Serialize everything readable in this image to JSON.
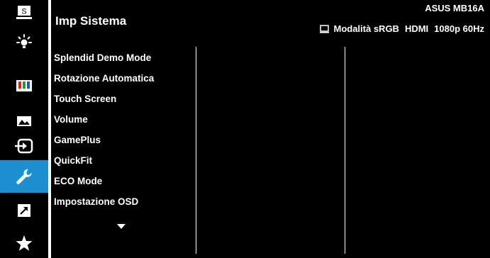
{
  "sidebar": {
    "items": [
      {
        "icon": "splendid-icon",
        "label": "S"
      },
      {
        "icon": "blue-light-filter-icon"
      },
      {
        "icon": "color-icon"
      },
      {
        "icon": "image-icon"
      },
      {
        "icon": "input-selection-icon"
      },
      {
        "icon": "system-setup-icon"
      },
      {
        "icon": "shortcut-icon"
      },
      {
        "icon": "favorite-icon"
      }
    ],
    "active_index": 5
  },
  "header": {
    "title": "Imp Sistema",
    "model": "ASUS MB16A",
    "mode": "Modalità sRGB",
    "input": "HDMI",
    "resolution": "1080p 60Hz"
  },
  "menu": {
    "items": [
      "Splendid Demo Mode",
      "Rotazione Automatica",
      "Touch Screen",
      "Volume",
      "GamePlus",
      "QuickFit",
      "ECO Mode",
      "Impostazione OSD"
    ]
  },
  "colors": {
    "accent": "#1c8fd1",
    "background": "#000000",
    "text": "#ffffff"
  }
}
